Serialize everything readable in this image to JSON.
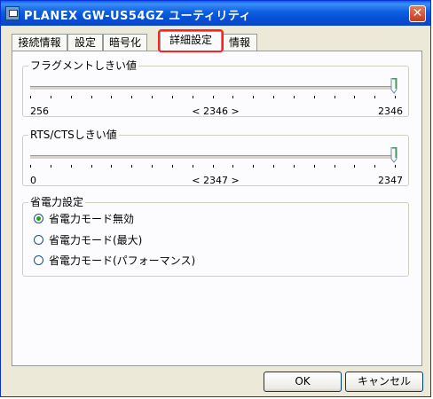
{
  "window": {
    "title": "PLANEX GW-US54GZ ユーティリティ",
    "close_glyph": "✕"
  },
  "tabs": [
    {
      "label": "接続情報"
    },
    {
      "label": "設定"
    },
    {
      "label": "暗号化"
    },
    {
      "label": "詳細設定",
      "active": true
    },
    {
      "label": "情報"
    }
  ],
  "fragment": {
    "title": "フラグメントしきい値",
    "min": "256",
    "max": "2346",
    "current": "< 2346 >",
    "value": 2346
  },
  "rts": {
    "title": "RTS/CTSしきい値",
    "min": "0",
    "max": "2347",
    "current": "< 2347 >",
    "value": 2347
  },
  "power": {
    "title": "省電力設定",
    "options": [
      {
        "label": "省電力モード無効",
        "checked": true
      },
      {
        "label": "省電力モード(最大)",
        "checked": false
      },
      {
        "label": "省電力モード(パフォーマンス)",
        "checked": false
      }
    ]
  },
  "buttons": {
    "ok": "OK",
    "cancel": "キャンセル"
  }
}
